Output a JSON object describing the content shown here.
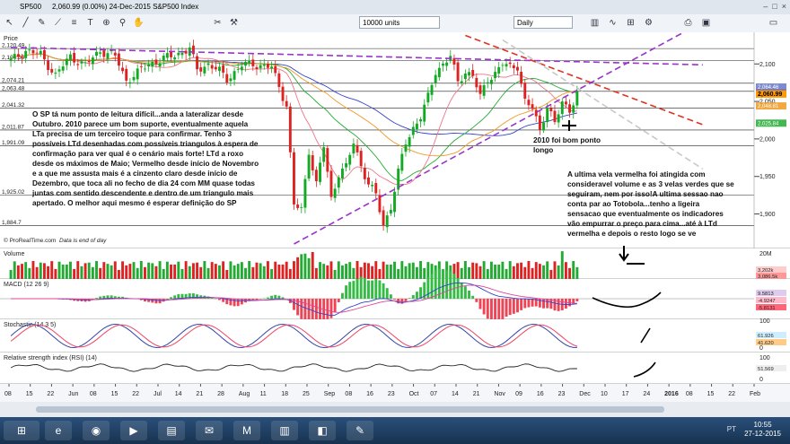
{
  "window": {
    "symbol": "SP500",
    "quote": "2,060.99 (0.00%) 24-Dec-2015 S&P500 Index",
    "controls": [
      "–",
      "□",
      "×"
    ]
  },
  "toolbar": {
    "units_value": "10000 units",
    "timeframe_value": "Daily",
    "icons": [
      "arrow-icon",
      "line-icon",
      "pencil-icon",
      "trend-icon",
      "fib-icon",
      "text-icon",
      "target-icon",
      "zoom-icon",
      "hand-icon",
      "scissors-icon",
      "tools-icon"
    ]
  },
  "price_panel": {
    "label": "Price",
    "source": "© ProRealTime.com",
    "source_note": "Data is end of day",
    "left_levels": [
      "2,120.49",
      "2,104.35",
      "2,074.21",
      "2,063.48",
      "2,041.32",
      "2,011.87",
      "1,991.09",
      "1,925.02",
      "1,884.7"
    ],
    "right_axis": [
      "2,100",
      "2,050",
      "2,000",
      "1,950",
      "1,900"
    ],
    "last_price_badge": "2,060.99",
    "ma_badges": [
      "2,064.46",
      "2,048.81",
      "2,025.84"
    ]
  },
  "volume_panel": {
    "label": "Volume",
    "axis": [
      "20M"
    ],
    "badges": [
      "3,202k",
      "3,086.5k"
    ]
  },
  "macd_panel": {
    "label": "MACD (12 26 9)",
    "badges": [
      "9.5813",
      "-4.9247",
      "-5.8131"
    ]
  },
  "stoch_panel": {
    "label": "Stochastic (14 3 5)",
    "axis": [
      "100",
      "50",
      "0"
    ],
    "badges": [
      "61.926",
      "41.620"
    ]
  },
  "rsi_panel": {
    "label": "Relative strength index (RSI) (14)",
    "axis": [
      "100",
      "0"
    ],
    "badges": [
      "51.569"
    ]
  },
  "annotations": {
    "left_note": "O SP tá num ponto de leitura difícil...anda a lateralizar desde\nOutubro. 2010 parece um bom suporte, eventualmente aquela\nLTa precisa de um terceiro toque para confirmar. Tenho 3\npossíveis LTd desenhadas com possíveis triangulos à espera de\nconfirmação para ver qual é o cenário mais forte! LTd a roxo\ndesde os máximos de Maio; Vermelho desde início de Novembro\ne a que me assusta mais é a cinzento claro desde início de\nDezembro, que toca ali no fecho de dia 24 com MM quase todas\njuntas com sentido descendente e dentro de um triangulo mais\napertado. O melhor aqui mesmo é esperar definição do SP",
    "support_note": "2010 foi bom ponto\nlongo",
    "right_note": "A ultima vela vermelha foi atingida com\nconsideravel volume e as 3 velas verdes que se\nseguiram, nem por isso!A ultima sessao nao\nconta par ao Totobola...tenho a ligeira\nsensacao que eventualmente os indicadores\nvão empurrar o preço para cima...até à LTd\nvermelha e depois o resto logo se ve"
  },
  "clock": {
    "time": "10:55",
    "date": "27-12-2015"
  },
  "tray_text": "PT",
  "chart_data": {
    "type": "candlestick",
    "x_tick_labels": [
      "08",
      "15",
      "22",
      "Jun",
      "08",
      "15",
      "22",
      "Jul",
      "14",
      "21",
      "28",
      "Aug",
      "11",
      "18",
      "25",
      "Sep",
      "08",
      "16",
      "23",
      "Oct",
      "07",
      "14",
      "21",
      "Nov",
      "09",
      "16",
      "23",
      "Dec",
      "10",
      "17",
      "24",
      "2016",
      "08",
      "15",
      "22",
      "Feb"
    ],
    "y_range": [
      1860,
      2135
    ],
    "anchors": [
      [
        0,
        2104
      ],
      [
        4,
        2118
      ],
      [
        8,
        2112
      ],
      [
        12,
        2085
      ],
      [
        16,
        2110
      ],
      [
        20,
        2098
      ],
      [
        24,
        2118
      ],
      [
        28,
        2110
      ],
      [
        31,
        2078
      ],
      [
        34,
        2088
      ],
      [
        37,
        2100
      ],
      [
        40,
        2105
      ],
      [
        44,
        2112
      ],
      [
        48,
        2120
      ],
      [
        50,
        2092
      ],
      [
        53,
        2100
      ],
      [
        56,
        2090
      ],
      [
        58,
        2080
      ],
      [
        62,
        2098
      ],
      [
        65,
        2100
      ],
      [
        67,
        2098
      ],
      [
        70,
        2095
      ],
      [
        72,
        2070
      ],
      [
        74,
        2045
      ],
      [
        76,
        1912
      ],
      [
        78,
        1905
      ],
      [
        80,
        1985
      ],
      [
        82,
        1940
      ],
      [
        84,
        1990
      ],
      [
        86,
        1920
      ],
      [
        88,
        1955
      ],
      [
        90,
        1962
      ],
      [
        92,
        1995
      ],
      [
        94,
        1965
      ],
      [
        96,
        1940
      ],
      [
        98,
        1925
      ],
      [
        100,
        1885
      ],
      [
        102,
        1910
      ],
      [
        104,
        1955
      ],
      [
        106,
        1995
      ],
      [
        108,
        2015
      ],
      [
        110,
        2030
      ],
      [
        112,
        2055
      ],
      [
        114,
        2090
      ],
      [
        116,
        2100
      ],
      [
        118,
        2110
      ],
      [
        120,
        2075
      ],
      [
        122,
        2090
      ],
      [
        124,
        2085
      ],
      [
        126,
        2055
      ],
      [
        128,
        2080
      ],
      [
        130,
        2088
      ],
      [
        132,
        2100
      ],
      [
        134,
        2095
      ],
      [
        136,
        2098
      ],
      [
        138,
        2050
      ],
      [
        140,
        2040
      ],
      [
        142,
        2012
      ],
      [
        144,
        2045
      ],
      [
        146,
        2020
      ],
      [
        148,
        2048
      ],
      [
        150,
        2040
      ],
      [
        152,
        2060
      ]
    ],
    "moving_averages": [
      "blue",
      "green",
      "pink",
      "orange"
    ],
    "trendlines": [
      {
        "color": "purple",
        "style": "dashed",
        "from": [
          0,
          2122
        ],
        "to": [
          152,
          2103
        ]
      },
      {
        "color": "red",
        "style": "dashed",
        "from": [
          122,
          2138
        ],
        "to": [
          152,
          2082
        ]
      },
      {
        "color": "gray",
        "style": "dashed",
        "from": [
          132,
          2132
        ],
        "to": [
          152,
          2068
        ]
      },
      {
        "color": "purple",
        "style": "dashed",
        "from": [
          76,
          1860
        ],
        "to": [
          152,
          2065
        ]
      }
    ]
  }
}
